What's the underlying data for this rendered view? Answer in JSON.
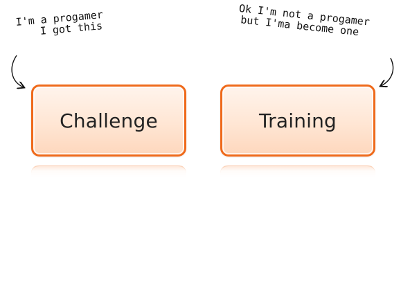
{
  "notes": {
    "left": {
      "line1": "I'm a progamer",
      "line2": "I got this"
    },
    "right": {
      "line1": "Ok I'm not a progamer",
      "line2": "but I'ma become one"
    }
  },
  "buttons": {
    "challenge": "Challenge",
    "training": "Training"
  },
  "colors": {
    "button_border": "#ef6a1b",
    "button_fill_top": "#fff4ec",
    "button_fill_bottom": "#fdd7bd",
    "text": "#222222",
    "annotation": "#111111"
  }
}
